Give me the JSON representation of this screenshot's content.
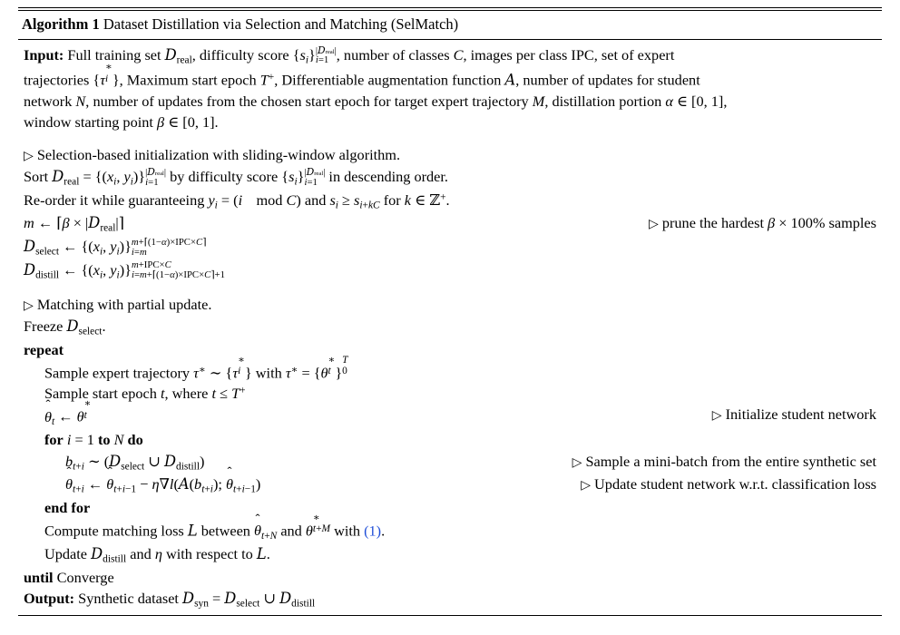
{
  "document": {
    "type": "algorithm-float",
    "caption_label": "Algorithm 1",
    "caption_title": "Dataset Distillation via Selection and Matching (SelMatch)",
    "link_color": "#1f4ed8"
  },
  "input_block": {
    "label": "Input:",
    "text_line1": "Full training set D_real, difficulty score {s_i}_{i=1}^{|D_real|}, number of classes C, images per class IPC, set of expert",
    "text_line2": "trajectories {tau*_i}, Maximum start epoch T^+, Differentiable augmentation function A, number of updates for student",
    "text_line3": "network N, number of updates from the chosen start epoch for target expert trajectory M, distillation portion alpha in [0,1],",
    "text_line4": "window starting point beta in [0,1]."
  },
  "section1": {
    "comment": "Selection-based initialization with sliding-window algorithm.",
    "sort_line": "Sort D_real = {(x_i, y_i)}_{i=1}^{|D_real|} by difficulty score {s_i}_{i=1}^{|D_real|} in descending order.",
    "reorder_line": "Re-order it while guaranteeing y_i = (i mod C) and s_i >= s_{i+kC} for k in Z^+.",
    "m_assign": "m <- ceil(beta x |D_real|)",
    "m_comment": "prune the hardest beta x 100% samples",
    "dselect_line": "D_select <- {(x_i, y_i)}_{i=m}^{m + ceil((1-alpha) x IPC x C)}",
    "ddistill_line": "D_distill <- {(x_i, y_i)}_{i=m+ceil((1-alpha) x IPC x C)+1}^{m + IPC x C}"
  },
  "section2": {
    "comment": "Matching with partial update.",
    "freeze_line": "Freeze D_select.",
    "repeat_kw": "repeat",
    "sample_traj": "Sample expert trajectory tau* ~ {tau*_i} with tau* = {theta*_t}_0^T",
    "sample_epoch": "Sample start epoch t, where t <= T^+",
    "init_student": "theta-hat_t <- theta*_t",
    "init_student_comment": "Initialize student network",
    "for_kw": "for",
    "for_mid": "to",
    "for_end_kw": "do",
    "for_var": "i = 1",
    "for_bound": "N",
    "batch_line": "b_{t+i} ~ (D_select U D_distill)",
    "batch_comment": "Sample a mini-batch from the entire synthetic set",
    "update_line": "theta-hat_{t+i} <- theta-hat_{t+i-1} - eta grad l(A(b_{t+i}); theta-hat_{t+i-1})",
    "update_comment": "Update student network w.r.t. classification loss",
    "end_for_kw": "end for",
    "compute_loss": "Compute matching loss L between theta-hat_{t+N} and theta*_{t+M} with (1).",
    "eq_ref": "(1)",
    "update_distill": "Update D_distill and eta with respect to L.",
    "until_kw": "until",
    "until_cond": "Converge"
  },
  "output_block": {
    "label": "Output:",
    "text": "Synthetic dataset D_syn = D_select U D_distill"
  }
}
